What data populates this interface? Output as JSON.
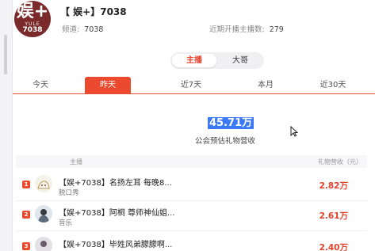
{
  "header": {
    "avatar_text": "娱+",
    "avatar_sub": "YULE",
    "avatar_num": "7038",
    "streamer_name": "【 娱+】7038",
    "channel_label": "频道:",
    "channel_value": "7038",
    "recent_label": "近期开播主播数:",
    "recent_value": "279"
  },
  "segment": {
    "options": [
      "主播",
      "大哥"
    ],
    "selected": "主播"
  },
  "tabs": [
    "今天",
    "昨天",
    "近7天",
    "本月",
    "近30天"
  ],
  "active_tab": "昨天",
  "stat": {
    "value": "45.71万",
    "label": "公会预估礼物营收"
  },
  "table": {
    "col_anchor": "主播",
    "col_value": "礼物营收（元）",
    "rows": [
      {
        "rank": "1",
        "title": "【娱+7038】名扬左耳 每晚8...",
        "sub": "脱口秀",
        "value": "2.82万"
      },
      {
        "rank": "2",
        "title": "【娱+7038】阿桐 尊师神仙姐...",
        "sub": "音乐",
        "value": "2.61万"
      },
      {
        "rank": "3",
        "title": "【娱+7038】毕姓风弟朦朦啊...",
        "sub": "",
        "value": "2.40万"
      }
    ]
  },
  "colors": {
    "accent": "#ec4a2f",
    "highlight": "#3b79f5"
  }
}
